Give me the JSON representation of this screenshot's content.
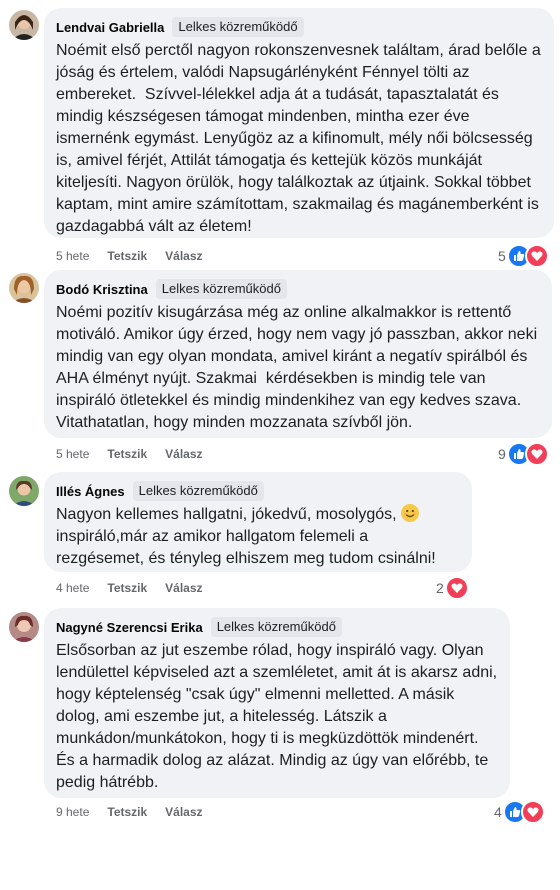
{
  "comments": [
    {
      "author": "Lendvai Gabriella",
      "badge": "Lelkes közreműködő",
      "text": "Noémit első perctől nagyon rokonszenvesnek találtam, árad belőle a jóság és értelem, valódi Napsugárlényként Fénnyel tölti az embereket.  Szívvel-lélekkel adja át a tudását, tapasztalatát és mindig készségesen támogat mindenben, mintha ezer éve ismernénk egymást. Lenyűgöz az a kifinomult, mély női bölcsesség is, amivel férjét, Attilát támogatja és kettejük közös munkáját kiteljesíti. Nagyon örülök, hogy találkoztak az útjaink. Sokkal többet kaptam, mint amire számítottam, szakmailag és magánemberként is gazdagabbá vált az életem!",
      "time": "5 hete",
      "like_label": "Tetszik",
      "reply_label": "Válasz",
      "reaction_count": "5",
      "reactions": [
        "like",
        "love"
      ]
    },
    {
      "author": "Bodó Krisztina",
      "badge": "Lelkes közreműködő",
      "text": "Noémi pozitív kisugárzása még az online alkalmakkor is rettentő motiváló. Amikor úgy érzed, hogy nem vagy jó passzban, akkor neki mindig van egy olyan mondata, amivel kiránt a negatív spirálból és AHA élményt nyújt. Szakmai  kérdésekben is mindig tele van inspiráló ötletekkel és mindig mindenkihez van egy kedves szava. Vitathatatlan, hogy minden mozzanata szívből jön.",
      "time": "5 hete",
      "like_label": "Tetszik",
      "reply_label": "Válasz",
      "reaction_count": "9",
      "reactions": [
        "like",
        "love"
      ]
    },
    {
      "author": "Illés Ágnes",
      "badge": "Lelkes közreműködő",
      "text_before": "Nagyon kellemes hallgatni, jókedvű, mosolygós, ",
      "text_after": "inspiráló,már az amikor hallgatom felemeli a rezgésemet, és tényleg elhiszem meg tudom csinálni!",
      "emoji": "smiling-face-emoji",
      "time": "4 hete",
      "like_label": "Tetszik",
      "reply_label": "Válasz",
      "reaction_count": "2",
      "reactions": [
        "love"
      ]
    },
    {
      "author": "Nagyné Szerencsi Erika",
      "badge": "Lelkes közreműködő",
      "text": "Elsősorban az jut eszembe rólad, hogy inspiráló vagy. Olyan lendülettel képviseled azt a szemléletet, amit át is akarsz adni, hogy képtelenség \"csak úgy\" elmenni melletted. A másik dolog, ami eszembe jut, a hitelesség. Látszik a munkádon/munkátokon, hogy ti is megküzdöttök mindenért. És a harmadik dolog az alázat. Mindig az úgy van előrébb, te pedig hátrébb.",
      "time": "9 hete",
      "like_label": "Tetszik",
      "reply_label": "Válasz",
      "reaction_count": "4",
      "reactions": [
        "like",
        "love"
      ]
    }
  ],
  "colors": {
    "bubble": "#f0f2f5",
    "like": "#1877f2",
    "love": "#f33e58",
    "meta": "#65676b"
  }
}
